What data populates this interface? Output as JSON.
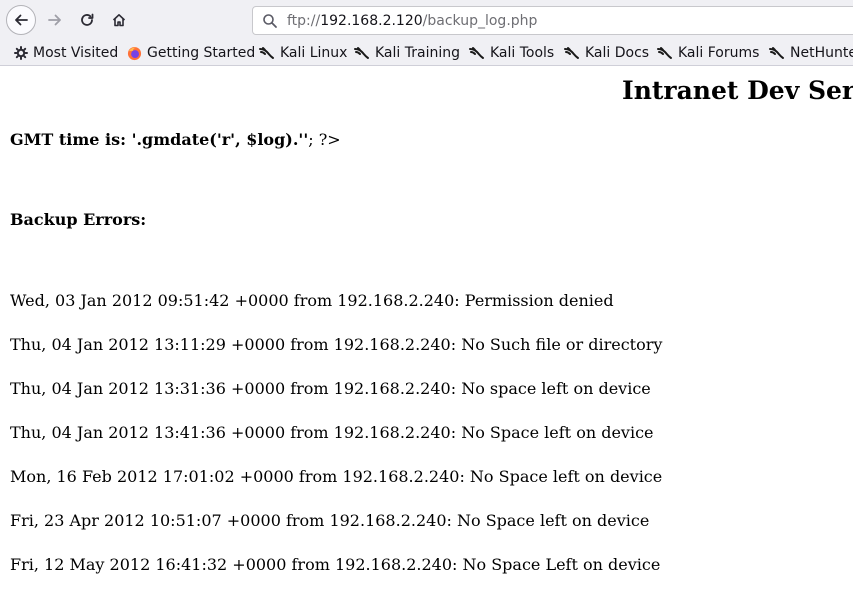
{
  "browser": {
    "url_base": "ftp://",
    "url_host": "192.168.2.120",
    "url_path": "/backup_log.php",
    "icons": {
      "back": "arrow-left-icon",
      "forward": "arrow-right-icon",
      "reload": "reload-icon",
      "home": "home-icon",
      "search": "search-icon"
    }
  },
  "bookmarks": [
    {
      "label": "Most Visited",
      "icon": "gear-icon"
    },
    {
      "label": "Getting Started",
      "icon": "firefox-icon"
    },
    {
      "label": "Kali Linux",
      "icon": "kali-dragon-icon"
    },
    {
      "label": "Kali Training",
      "icon": "kali-dragon-icon"
    },
    {
      "label": "Kali Tools",
      "icon": "kali-dragon-icon"
    },
    {
      "label": "Kali Docs",
      "icon": "kali-dragon-icon"
    },
    {
      "label": "Kali Forums",
      "icon": "kali-dragon-icon"
    },
    {
      "label": "NetHunte",
      "icon": "kali-dragon-icon"
    }
  ],
  "page": {
    "title": "Intranet Dev Serv",
    "gmt_bold": "GMT time is: '.gmdate('r', $log).''",
    "gmt_rest": "; ?>",
    "errors_heading": "Backup Errors:",
    "log_entries": [
      "Wed, 03 Jan 2012 09:51:42 +0000 from 192.168.2.240: Permission denied",
      "Thu, 04 Jan 2012 13:11:29 +0000 from 192.168.2.240: No Such file or directory",
      "Thu, 04 Jan 2012 13:31:36 +0000 from 192.168.2.240: No space left on device",
      "Thu, 04 Jan 2012 13:41:36 +0000 from 192.168.2.240: No Space left on device",
      "Mon, 16 Feb 2012 17:01:02 +0000 from 192.168.2.240: No Space left on device",
      "Fri, 23 Apr 2012 10:51:07 +0000 from 192.168.2.240: No Space left on device",
      "Fri, 12 May 2012 16:41:32 +0000 from 192.168.2.240: No Space Left on device"
    ]
  }
}
